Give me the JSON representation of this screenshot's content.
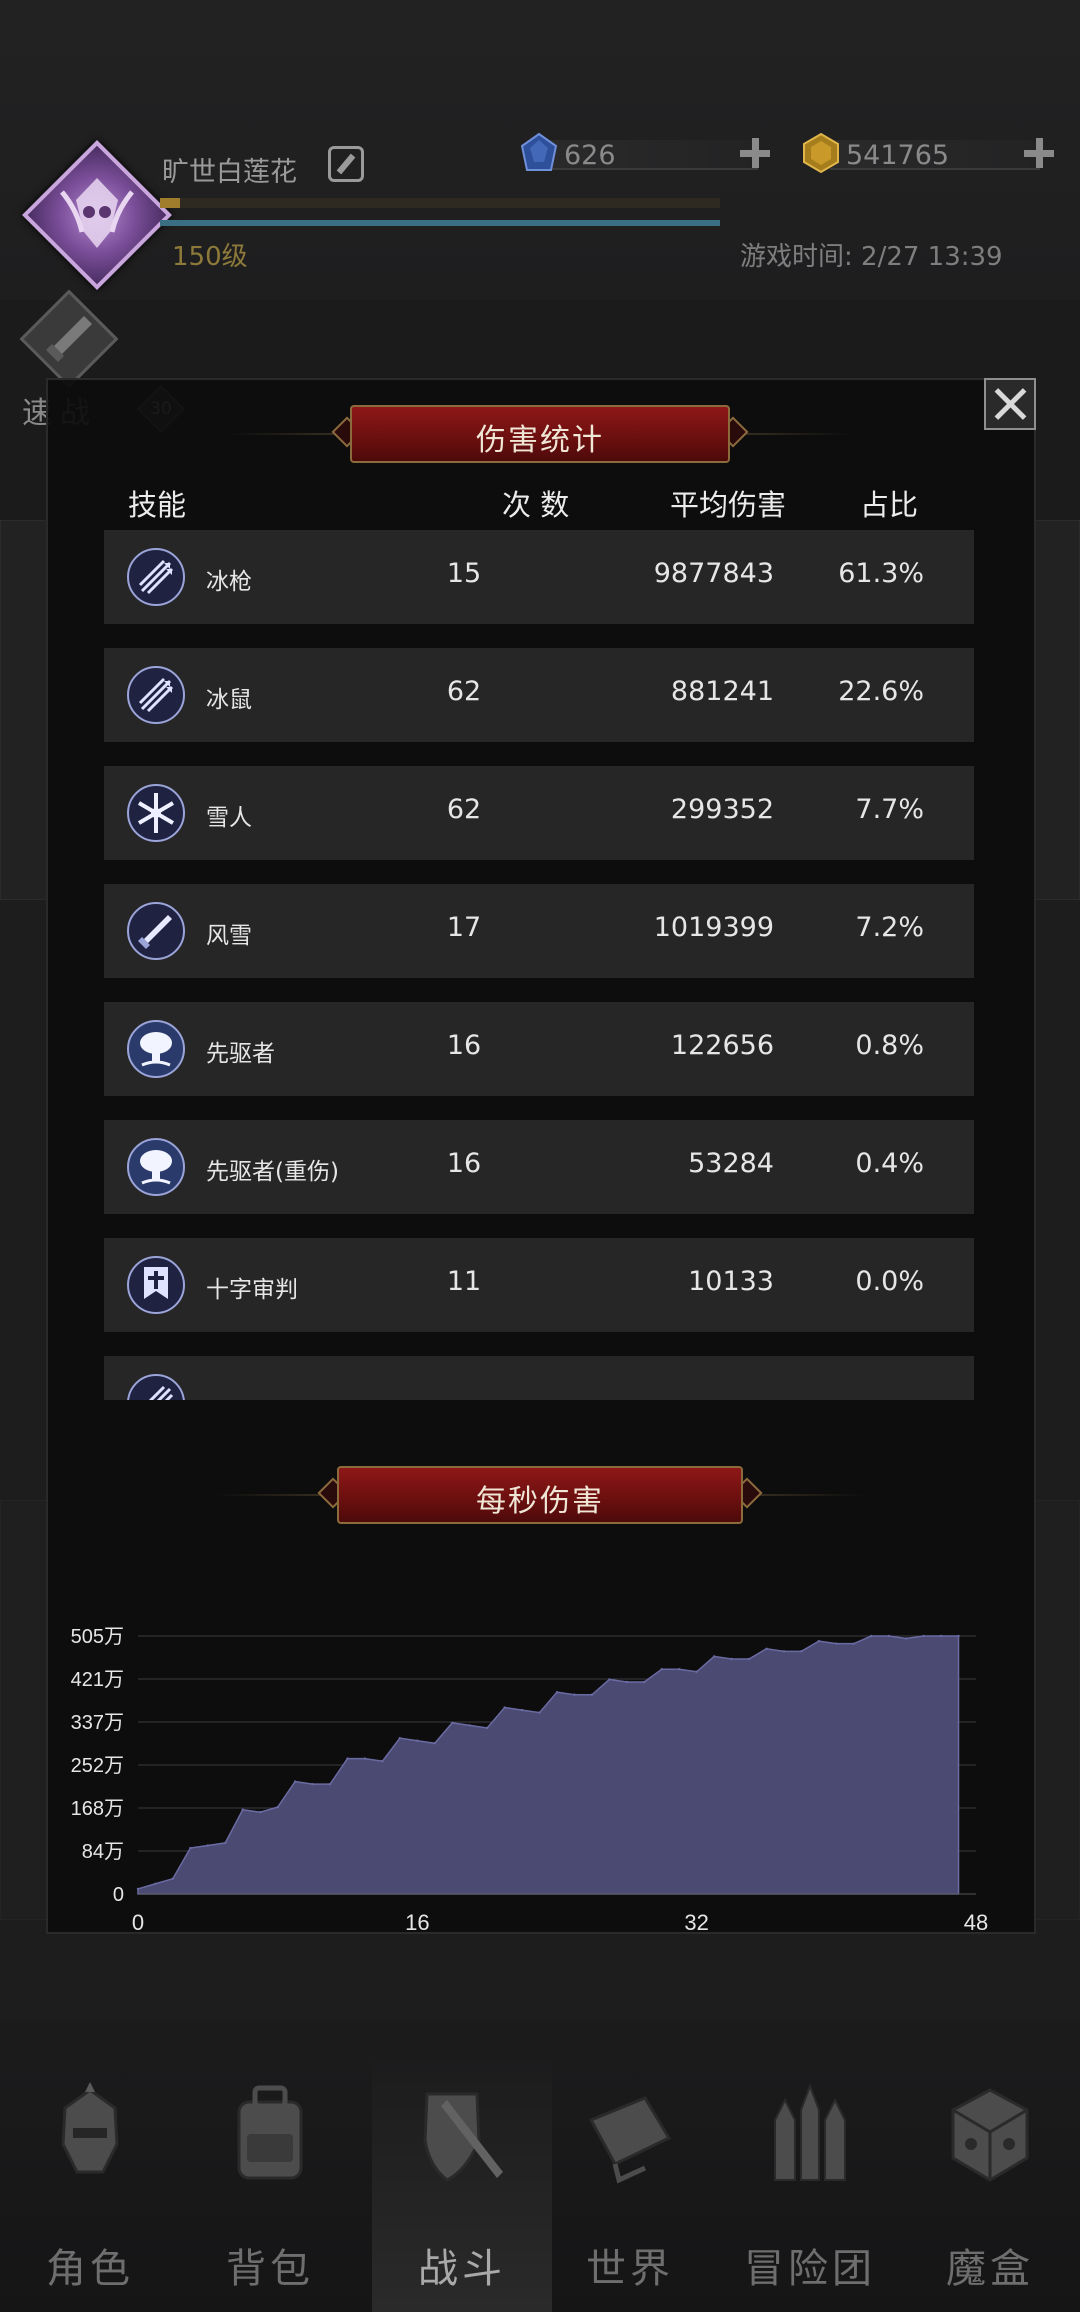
{
  "player": {
    "name": "旷世白莲花",
    "level_text": "150级",
    "avatar_badge": "30",
    "game_time": "游戏时间: 2/27 13:39"
  },
  "currencies": {
    "diamonds": "626",
    "gold": "541765"
  },
  "quick_battle": {
    "label": "速战"
  },
  "damage_panel": {
    "title": "伤害统计",
    "columns": {
      "skill": "技能",
      "count": "次 数",
      "avg": "平均伤害",
      "share": "占比"
    },
    "rows": [
      {
        "icon": "arrows-icon",
        "name": "冰枪",
        "count": "15",
        "avg": "9877843",
        "share": "61.3%"
      },
      {
        "icon": "arrows-icon",
        "name": "冰鼠",
        "count": "62",
        "avg": "881241",
        "share": "22.6%"
      },
      {
        "icon": "snowflake-icon",
        "name": "雪人",
        "count": "62",
        "avg": "299352",
        "share": "7.7%"
      },
      {
        "icon": "sword-icon",
        "name": "风雪",
        "count": "17",
        "avg": "1019399",
        "share": "7.2%"
      },
      {
        "icon": "mushroom-cloud-icon",
        "name": "先驱者",
        "count": "16",
        "avg": "122656",
        "share": "0.8%"
      },
      {
        "icon": "mushroom-cloud-icon",
        "name": "先驱者(重伤)",
        "count": "16",
        "avg": "53284",
        "share": "0.4%"
      },
      {
        "icon": "banner-icon",
        "name": "十字审判",
        "count": "11",
        "avg": "10133",
        "share": "0.0%"
      },
      {
        "icon": "arrows-icon",
        "name": "",
        "count": "",
        "avg": "",
        "share": ""
      }
    ]
  },
  "dps_panel": {
    "title": "每秒伤害"
  },
  "chart_data": {
    "type": "area",
    "title": "每秒伤害",
    "y_tick_labels": [
      "0",
      "84万",
      "168万",
      "252万",
      "337万",
      "421万",
      "505万"
    ],
    "x_tick_labels": [
      "0",
      "16",
      "32",
      "48"
    ],
    "xlim": [
      0,
      48
    ],
    "ylim": [
      0,
      505
    ],
    "y_unit": "万",
    "grid": true,
    "fill_color": "#4a4a72",
    "x": [
      0,
      1,
      2,
      3,
      4,
      5,
      6,
      7,
      8,
      9,
      10,
      11,
      12,
      13,
      14,
      15,
      16,
      17,
      18,
      19,
      20,
      21,
      22,
      23,
      24,
      25,
      26,
      27,
      28,
      29,
      30,
      31,
      32,
      33,
      34,
      35,
      36,
      37,
      38,
      39,
      40,
      41,
      42,
      43,
      44,
      45,
      46,
      47
    ],
    "y": [
      10,
      20,
      30,
      90,
      95,
      100,
      165,
      160,
      170,
      220,
      215,
      215,
      265,
      265,
      260,
      305,
      300,
      295,
      335,
      330,
      325,
      365,
      360,
      355,
      395,
      390,
      390,
      420,
      415,
      415,
      440,
      440,
      435,
      465,
      460,
      460,
      480,
      475,
      475,
      495,
      490,
      490,
      510,
      505,
      500,
      515,
      520,
      520
    ]
  },
  "nav": {
    "items": [
      {
        "label": "角色",
        "icon": "helmet-icon"
      },
      {
        "label": "背包",
        "icon": "backpack-icon"
      },
      {
        "label": "战斗",
        "icon": "sword-shield-icon",
        "active": true
      },
      {
        "label": "世界",
        "icon": "scroll-map-icon"
      },
      {
        "label": "冒险团",
        "icon": "castle-icon"
      },
      {
        "label": "魔盒",
        "icon": "cube-icon"
      }
    ]
  },
  "colors": {
    "banner_red": "#8e1717",
    "banner_gold": "#8b6a3c",
    "chart_fill": "#4a4a72",
    "level_gold": "#8d7a3a"
  }
}
